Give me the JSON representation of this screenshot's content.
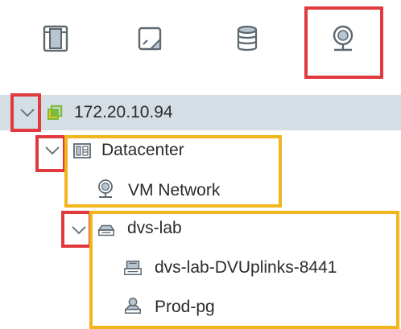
{
  "toolbar": {
    "tabs": [
      {
        "name": "hosts-and-clusters",
        "icon": "hosts-clusters-icon"
      },
      {
        "name": "vms-and-templates",
        "icon": "vms-templates-icon"
      },
      {
        "name": "storage",
        "icon": "storage-icon"
      },
      {
        "name": "networking",
        "icon": "networking-icon"
      }
    ],
    "selected_tab": "networking"
  },
  "tree": {
    "nodes": [
      {
        "label": "172.20.10.94",
        "icon": "vcenter-icon",
        "expanded": true,
        "selected": true
      },
      {
        "label": "Datacenter",
        "icon": "datacenter-icon",
        "expanded": true
      },
      {
        "label": "VM Network",
        "icon": "network-icon"
      },
      {
        "label": "dvs-lab",
        "icon": "distributed-switch-icon",
        "expanded": true
      },
      {
        "label": "dvs-lab-DVUplinks-8441",
        "icon": "uplink-portgroup-icon"
      },
      {
        "label": "Prod-pg",
        "icon": "portgroup-icon"
      }
    ]
  },
  "colors": {
    "highlight_red": "#e03a3e",
    "highlight_yellow": "#f2b51c",
    "selected_row": "#d6dee5",
    "icon_gray": "#5c6770",
    "vcenter_green": "#7dbb3b",
    "vcenter_yellow": "#f0c21b"
  }
}
